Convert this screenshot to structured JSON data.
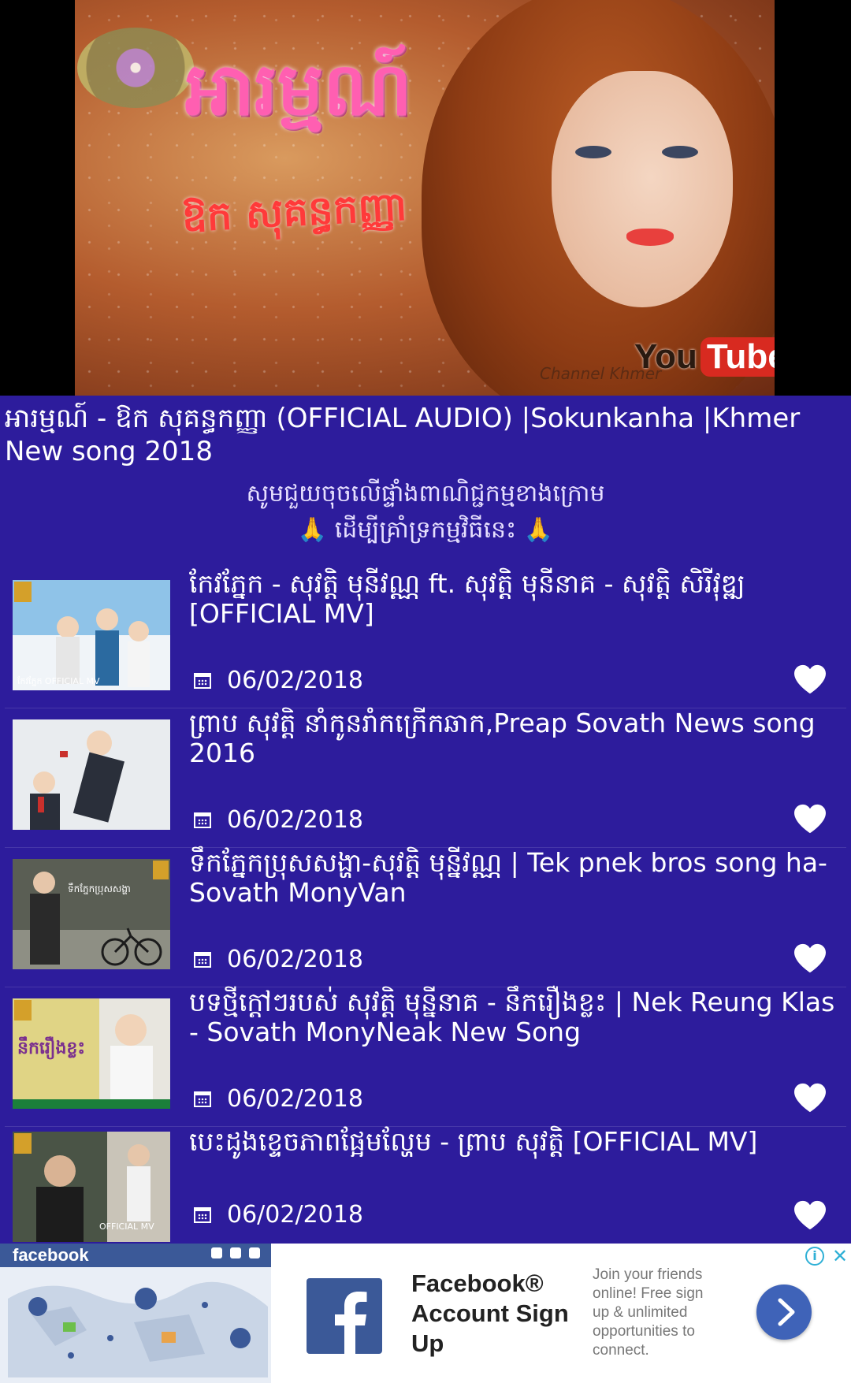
{
  "hero": {
    "title_art": "អារម្មណ៍",
    "subtitle_art": "ឱក សុគន្ធកញ្ញា",
    "channel_mark": "Channel Khmer",
    "youtube_you": "You",
    "youtube_tube": "Tube"
  },
  "video": {
    "title": "អារម្មណ៍ - ឱក សុគន្ធកញ្ញា (OFFICIAL AUDIO) |Sokunkanha |Khmer New song 2018"
  },
  "appeal": {
    "line1": "សូមជួយចុចលើផ្ទាំងពាណិជ្ជកម្មខាងក្រោម",
    "line2": "ដើម្បីគ្រាំទ្រកម្មវិធីនេះ",
    "pray_icon": "🙏"
  },
  "colors": {
    "background": "#2d1c9c",
    "facebook_blue": "#3b5998"
  },
  "items": [
    {
      "title": "កែវភ្នែក - សុវត្តិ មុនីវណ្ណ ft. សុវត្តិ មុនីនាគ - សុវត្តិ សិរីវុឌ្ឍ [OFFICIAL MV]",
      "date": "06/02/2018",
      "thumb_label": "កែវភ្នែក OFFICIAL MV",
      "thumb_colors": [
        "#8fc3e8",
        "#f0f4f8",
        "#2b6aa0"
      ]
    },
    {
      "title": "ព្រាប សុវត្តិ នាំកូនរាំកក្រើកឆាក,Preap Sovath News song 2016",
      "date": "06/02/2018",
      "thumb_label": "",
      "thumb_colors": [
        "#e9ecef",
        "#2a2f3a",
        "#c9302c"
      ]
    },
    {
      "title": "ទឹកភ្នែកប្រុសសង្ហា-សុវត្តិ មុន្នីវណ្ណ | Tek pnek bros song ha-Sovath MonyVan",
      "date": "06/02/2018",
      "thumb_label": "ទឹកភ្នែកប្រុសសង្ហា",
      "thumb_colors": [
        "#5a5e54",
        "#8e8f84",
        "#2a2a2a"
      ]
    },
    {
      "title": "បទថ្មីក្តៅៗរបស់ សុវត្តិ មុន្នីនាគ - នឹករឿងខ្លះ | Nek Reung Klas - Sovath MonyNeak New Song",
      "date": "06/02/2018",
      "thumb_label": "នឹករឿងខ្លះ",
      "thumb_colors": [
        "#d9c53a",
        "#e8e6df",
        "#7a2f8f"
      ]
    },
    {
      "title": "បេះដូងខ្ទេចភាពផ្អែមល្ហែម - ព្រាប សុវត្តិ [OFFICIAL MV]",
      "date": "06/02/2018",
      "thumb_label": "OFFICIAL MV",
      "thumb_colors": [
        "#4a5446",
        "#c9c4b8",
        "#1c1c1c"
      ]
    }
  ],
  "ad": {
    "brand": "facebook",
    "headline": "Facebook® Account Sign Up",
    "body": "Join your friends online! Free sign up & unlimited opportunities to connect.",
    "info_icon": "i",
    "close_icon": "✕"
  }
}
